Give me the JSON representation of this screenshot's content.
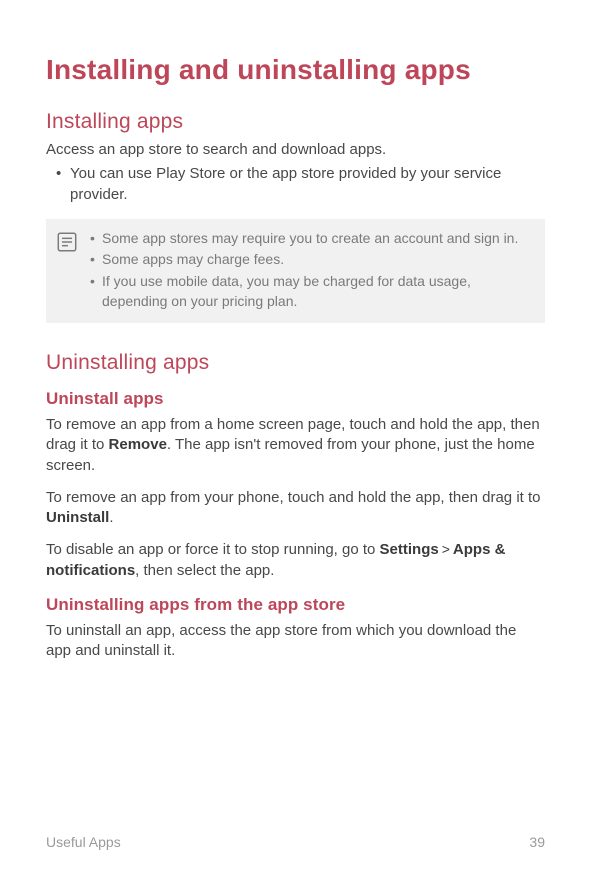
{
  "title": "Installing and uninstalling apps",
  "section1": {
    "heading": "Installing apps",
    "intro": "Access an app store to search and download apps.",
    "bullets": [
      "You can use Play Store or the app store provided by your service provider."
    ],
    "notes": [
      "Some app stores may require you to create an account and sign in.",
      "Some apps may charge fees.",
      "If you use mobile data, you may be charged for data usage, depending on your pricing plan."
    ]
  },
  "section2": {
    "heading": "Uninstalling apps",
    "sub1": {
      "heading": "Uninstall apps",
      "p1a": "To remove an app from a home screen page, touch and hold the app, then drag it to ",
      "p1b": "Remove",
      "p1c": ". The app isn't removed from your phone, just the home screen.",
      "p2a": "To remove an app from your phone, touch and hold the app, then drag it to ",
      "p2b": "Uninstall",
      "p2c": ".",
      "p3a": "To disable an app or force it to stop running, go to ",
      "p3b": "Settings",
      "p3c": "Apps & notifications",
      "p3d": ", then select the app."
    },
    "sub2": {
      "heading": "Uninstalling apps from the app store",
      "p1": "To uninstall an app, access the app store from which you download the app and uninstall it."
    }
  },
  "footer": {
    "left": "Useful Apps",
    "right": "39"
  }
}
